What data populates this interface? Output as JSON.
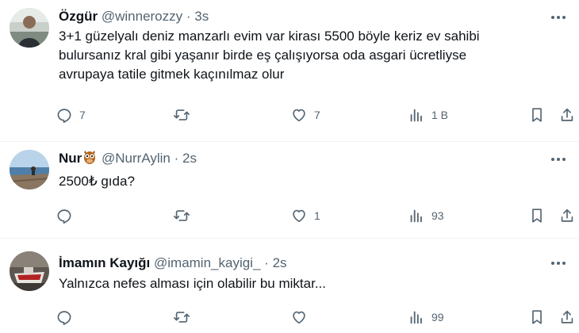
{
  "tweets": [
    {
      "name": "Özgür",
      "handle": "@winnerozzy",
      "separator": "·",
      "time": "3s",
      "text_lines": [
        "3+1 güzelyalı deniz manzarlı evim var kirası 5500 böyle keriz ev sahibi",
        "bulursanız kral gibi yaşanır birde eş çalışıyorsa oda asgari ücretliyse",
        "avrupaya tatile gitmek kaçınılmaz olur"
      ],
      "replies": "7",
      "reposts": "",
      "likes": "7",
      "views": "1 B"
    },
    {
      "name": "Nur",
      "name_emoji": "owl",
      "handle": "@NurrAylin",
      "separator": "·",
      "time": "2s",
      "text_lines": [
        "2500₺ gıda?"
      ],
      "replies": "",
      "reposts": "",
      "likes": "1",
      "views": "93"
    },
    {
      "name": "İmamın Kayığı",
      "handle": "@imamin_kayigi_",
      "separator": "·",
      "time": "2s",
      "text_lines": [
        "Yalnızca nefes alması için olabilir bu miktar..."
      ],
      "replies": "",
      "reposts": "",
      "likes": "",
      "views": "99"
    }
  ],
  "icons": [
    "more-icon",
    "reply-icon",
    "repost-icon",
    "like-icon",
    "views-icon",
    "bookmark-icon",
    "share-icon"
  ],
  "colors": {
    "text": "#0f1419",
    "muted": "#536471",
    "divider": "#eff3f4"
  }
}
